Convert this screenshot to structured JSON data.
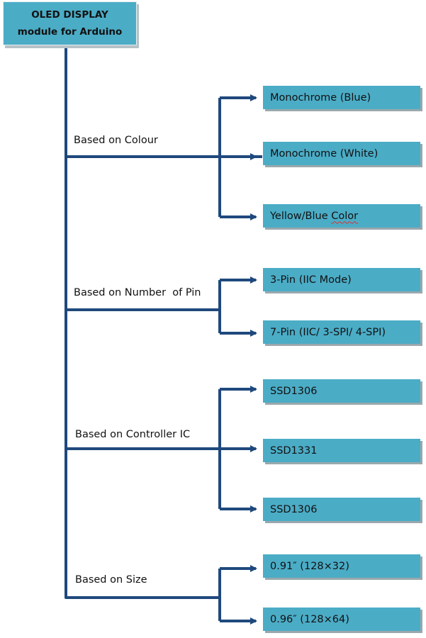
{
  "root": {
    "line1": "OLED DISPLAY",
    "line2": "module for Arduino"
  },
  "colors": {
    "box_fill": "#4bacc6",
    "connector": "#1f497d",
    "box_shadow": "#9aa8ad"
  },
  "categories": [
    {
      "label": "Based on Colour",
      "items": [
        "Monochrome (Blue)",
        "Monochrome (White)",
        "Yellow/Blue Color"
      ]
    },
    {
      "label": "Based on Number  of Pin",
      "items": [
        "3-Pin (IIC Mode)",
        "7-Pin (IIC/ 3-SPI/ 4-SPI)"
      ]
    },
    {
      "label": "Based on Controller IC",
      "items": [
        "SSD1306",
        "SSD1331",
        "SSD1306"
      ]
    },
    {
      "label": "Based on Size",
      "items": [
        "0.91″ (128×32)",
        "0.96″ (128×64)"
      ]
    }
  ],
  "spelling_flag": {
    "item_text": "Yellow/Blue Color",
    "flagged_word": "Color"
  }
}
